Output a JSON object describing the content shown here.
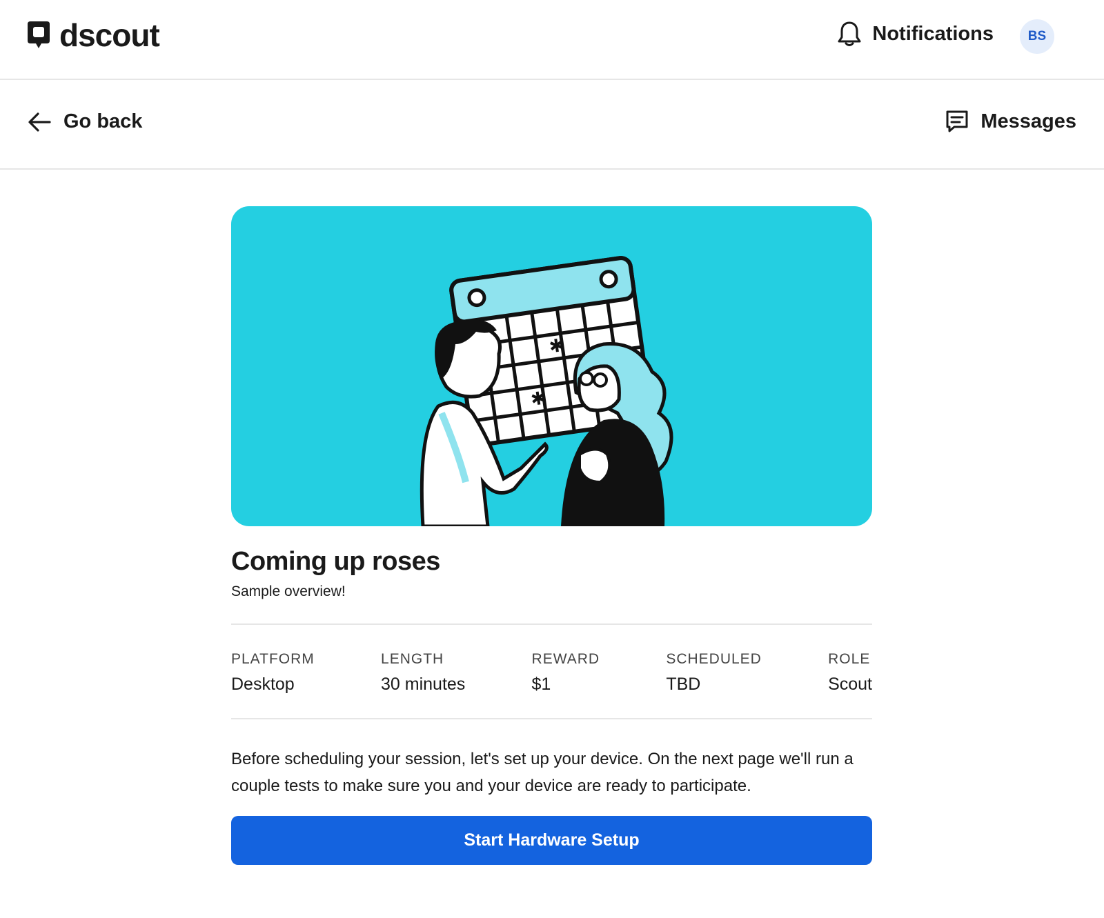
{
  "header": {
    "logo_text": "dscout",
    "notifications_label": "Notifications",
    "avatar_initials": "BS"
  },
  "subnav": {
    "back_label": "Go back",
    "messages_label": "Messages"
  },
  "mission": {
    "title": "Coming up roses",
    "subtitle": "Sample overview!",
    "meta": [
      {
        "label": "PLATFORM",
        "value": "Desktop"
      },
      {
        "label": "LENGTH",
        "value": "30 minutes"
      },
      {
        "label": "REWARD",
        "value": "$1"
      },
      {
        "label": "SCHEDULED",
        "value": "TBD"
      },
      {
        "label": "ROLE",
        "value": "Scout"
      }
    ],
    "description": "Before scheduling your session, let's set up your device. On the next page we'll run a couple tests to make sure you and your device are ready to participate.",
    "cta_label": "Start Hardware Setup"
  },
  "icons": {
    "logo": "dscout-logo-icon",
    "bell": "bell-icon",
    "back": "arrow-left-icon",
    "messages": "chat-icon"
  },
  "colors": {
    "hero_bg": "#24cfe1",
    "primary": "#1463df",
    "avatar_bg": "#e4edfb",
    "avatar_text": "#1f5bc8"
  }
}
